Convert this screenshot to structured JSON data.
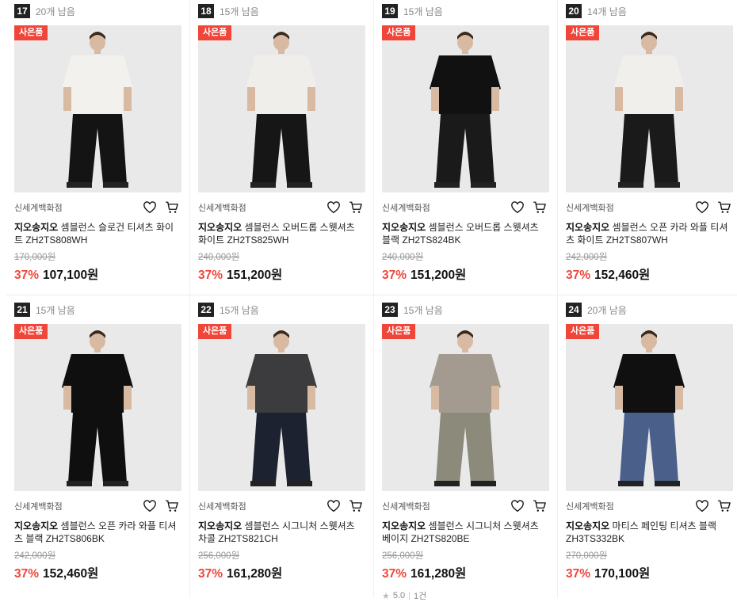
{
  "products": [
    {
      "rank": "17",
      "remain": "20개 남음",
      "badge": "사은품",
      "store": "신세계백화점",
      "brand": "지오송지오",
      "name": "셈블런스 슬로건 티셔츠 화이트 ZH2TS808WH",
      "orig_price": "170,000원",
      "discount": "37%",
      "price": "107,100원",
      "top": "#f2f1ee",
      "bottom": "#141414",
      "rating": null,
      "reviews": null
    },
    {
      "rank": "18",
      "remain": "15개 남음",
      "badge": "사은품",
      "store": "신세계백화점",
      "brand": "지오송지오",
      "name": "셈블런스 오버드롭 스웻셔츠 화이트 ZH2TS825WH",
      "orig_price": "240,000원",
      "discount": "37%",
      "price": "151,200원",
      "top": "#efeeea",
      "bottom": "#161616",
      "rating": null,
      "reviews": null
    },
    {
      "rank": "19",
      "remain": "15개 남음",
      "badge": "사은품",
      "store": "신세계백화점",
      "brand": "지오송지오",
      "name": "셈블런스 오버드롭 스웻셔츠 블랙 ZH2TS824BK",
      "orig_price": "240,000원",
      "discount": "37%",
      "price": "151,200원",
      "top": "#111111",
      "bottom": "#1a1a1a",
      "rating": null,
      "reviews": null
    },
    {
      "rank": "20",
      "remain": "14개 남음",
      "badge": "사은품",
      "store": "신세계백화점",
      "brand": "지오송지오",
      "name": "셈블런스 오픈 카라 와플 티셔츠 화이트 ZH2TS807WH",
      "orig_price": "242,000원",
      "discount": "37%",
      "price": "152,460원",
      "top": "#f0efec",
      "bottom": "#1a1a1a",
      "rating": null,
      "reviews": null
    },
    {
      "rank": "21",
      "remain": "15개 남음",
      "badge": "사은품",
      "store": "신세계백화점",
      "brand": "지오송지오",
      "name": "셈블런스 오픈 카라 와플 티셔츠 블랙 ZH2TS806BK",
      "orig_price": "242,000원",
      "discount": "37%",
      "price": "152,460원",
      "top": "#0f0f0f",
      "bottom": "#0f0f0f",
      "rating": null,
      "reviews": null
    },
    {
      "rank": "22",
      "remain": "15개 남음",
      "badge": "사은품",
      "store": "신세계백화점",
      "brand": "지오송지오",
      "name": "셈블런스 시그니처 스웻셔츠 차콜 ZH2TS821CH",
      "orig_price": "256,000원",
      "discount": "37%",
      "price": "161,280원",
      "top": "#3c3c3e",
      "bottom": "#1c2230",
      "rating": null,
      "reviews": null
    },
    {
      "rank": "23",
      "remain": "15개 남음",
      "badge": "사은품",
      "store": "신세계백화점",
      "brand": "지오송지오",
      "name": "셈블런스 시그니처 스웻셔츠 베이지 ZH2TS820BE",
      "orig_price": "256,000원",
      "discount": "37%",
      "price": "161,280원",
      "top": "#a39a90",
      "bottom": "#8c8a7a",
      "rating": "5.0",
      "reviews": "1건"
    },
    {
      "rank": "24",
      "remain": "20개 남음",
      "badge": "사은품",
      "store": "신세계백화점",
      "brand": "지오송지오",
      "name": "마티스 페인팅 티셔츠 블랙 ZH3TS332BK",
      "orig_price": "270,000원",
      "discount": "37%",
      "price": "170,100원",
      "top": "#101010",
      "bottom": "#4a5f8a",
      "rating": null,
      "reviews": null
    }
  ],
  "icons": {
    "wishlist": "heart-icon",
    "cart": "cart-icon",
    "star": "star-icon"
  },
  "colors": {
    "accent": "#f0463a",
    "rank_bg": "#222222"
  }
}
